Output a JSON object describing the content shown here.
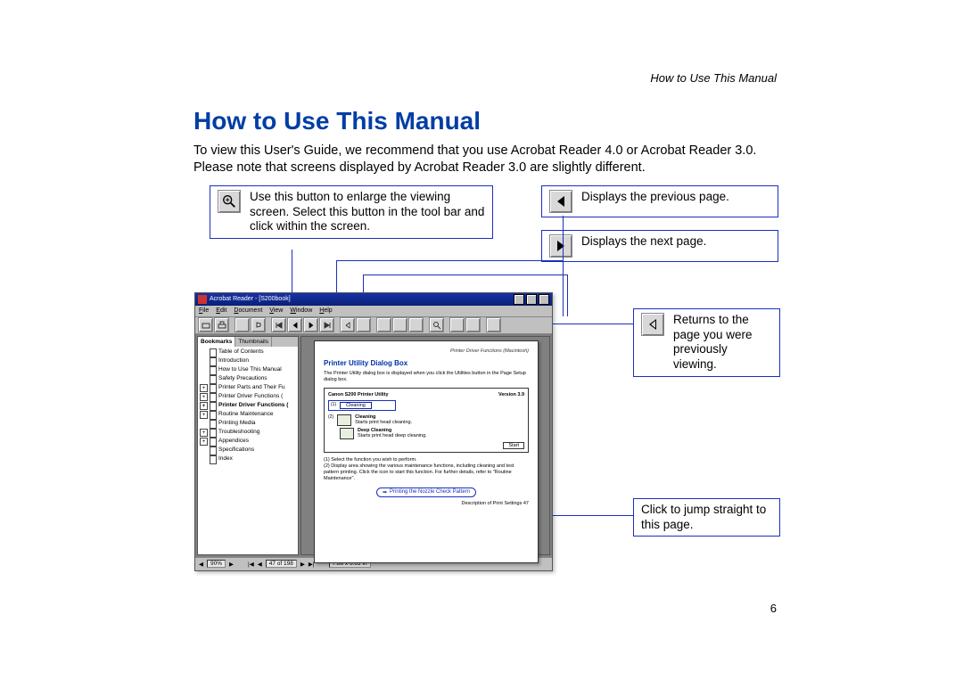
{
  "running_head": "How to Use This Manual",
  "heading": "How to Use This Manual",
  "intro": "To view this User's Guide, we recommend that you use Acrobat Reader 4.0 or Acrobat Reader 3.0.  Please note that screens displayed by Acrobat Reader 3.0 are slightly different.",
  "callouts": {
    "zoom": "Use this button to enlarge the viewing screen.  Select this button in the tool bar and click within the screen.",
    "prev": "Displays the previous page.",
    "next": "Displays the next page.",
    "back": "Returns to the page you were previously viewing.",
    "link": "Click to jump straight to this page."
  },
  "app": {
    "title": "Acrobat Reader - [S200book]",
    "menu": [
      "File",
      "Edit",
      "Document",
      "View",
      "Window",
      "Help"
    ],
    "sidebar": {
      "tab_active": "Bookmarks",
      "tab_other": "Thumbnails",
      "items": [
        {
          "label": "Table of Contents",
          "plus": false
        },
        {
          "label": "Introduction",
          "plus": false
        },
        {
          "label": "How to Use This Manual",
          "plus": false
        },
        {
          "label": "Safety Precautions",
          "plus": false
        },
        {
          "label": "Printer Parts and Their Fu",
          "plus": true
        },
        {
          "label": "Printer Driver Functions (",
          "plus": true
        },
        {
          "label": "Printer Driver Functions (",
          "plus": true,
          "bold": true
        },
        {
          "label": "Routine Maintenance",
          "plus": true
        },
        {
          "label": "Printing Media",
          "plus": false
        },
        {
          "label": "Troubleshooting",
          "plus": true
        },
        {
          "label": "Appendices",
          "plus": true
        },
        {
          "label": "Specifications",
          "plus": false
        },
        {
          "label": "Index",
          "plus": false
        }
      ]
    },
    "doc": {
      "head_right": "Printer Driver Functions (Macintosh)",
      "title": "Printer Utility Dialog Box",
      "para": "The Printer Utility dialog box is displayed when you click the Utilities button in the Page Setup dialog box.",
      "util_title_left": "Canon S200 Printer Utility",
      "util_title_right": "Version 3.9",
      "row1_label": "Cleaning",
      "row2_label": "Cleaning",
      "row2_sub": "Starts print head cleaning.",
      "row3_label": "Deep Cleaning",
      "row3_sub": "Starts print head deep cleaning.",
      "notes1": "(1)  Select the function you wish to perform.",
      "notes2": "(2)  Display area showing the various maintenance functions, including cleaning and test pattern printing. Click the icon to start this function. For further details, refer to \"Routine Maintenance\".",
      "link_label": "Printing the Nozzle Check Pattern",
      "foot_right": "Description of Print Settings    47"
    },
    "status": {
      "zoom": "90%",
      "page": "47 of 198",
      "size": "7.88 x 6.61 in"
    }
  },
  "page_number": "6"
}
